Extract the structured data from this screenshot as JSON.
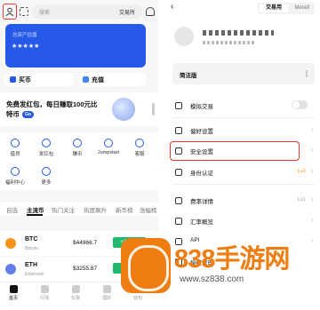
{
  "left": {
    "search_placeholder": "搜索",
    "exchange_label": "交易所",
    "asset_label": "总资产估值",
    "asset_value": "*****",
    "buy_label": "买币",
    "deposit_label": "充值",
    "promo_line1": "免费发红包，每日赚取100元比",
    "promo_line2": "特币",
    "promo_go": "Go",
    "grid": [
      "借贷",
      "发红包",
      "赚币",
      "Jumpstart",
      "客服",
      "福利中心",
      "更多"
    ],
    "tabs": [
      "自选",
      "主流币",
      "热门关注",
      "热度飙升",
      "新币榜",
      "涨幅榜"
    ],
    "coins": [
      {
        "sym": "BTC",
        "name": "Bitcoin",
        "price": "$44966.7",
        "change": "+2.41%"
      },
      {
        "sym": "ETH",
        "name": "Ethereum",
        "price": "$3255.87",
        "change": "+2.2%"
      }
    ],
    "nav": [
      "首页",
      "行情",
      "交易",
      "理财",
      "钱包"
    ]
  },
  "right": {
    "back_icon": "‹",
    "seg_a": "交易用",
    "seg_b": "MetaX",
    "banner_title": "简法版",
    "banner_desc": "",
    "rows": [
      {
        "label": "模拟交易",
        "sub": ""
      },
      {
        "label": "偏好设置",
        "sub": ""
      },
      {
        "label": "安全设置",
        "sub": ""
      },
      {
        "label": "身份认证",
        "value": "Lv2"
      },
      {
        "label": "费率详情",
        "value": "Lv1"
      },
      {
        "label": "汇率概览",
        "value": ""
      },
      {
        "label": "API",
        "value": ""
      },
      {
        "label": "授权管理",
        "value": ""
      }
    ],
    "highlight_color": "#e53935"
  },
  "watermark": {
    "brand": "838手游网",
    "url": "www.sz838.com"
  },
  "colors": {
    "accent": "#2659e8",
    "up": "#21b96b",
    "watermark": "#f07d12"
  }
}
